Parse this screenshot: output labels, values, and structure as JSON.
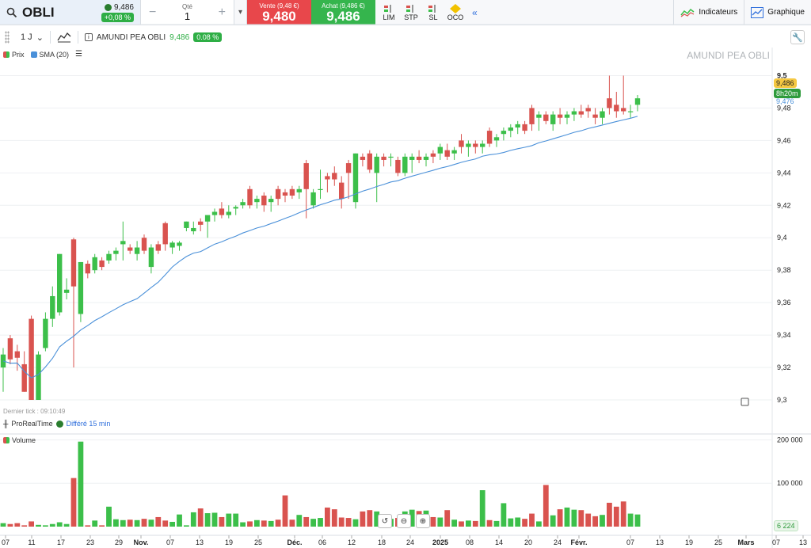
{
  "header": {
    "symbol": "OBLI",
    "last_price": "9,486",
    "change": "+0,08 %",
    "qty_label": "Qté",
    "qty_value": "1",
    "sell_label": "Vente (9,48 €)",
    "sell_price": "9,480",
    "buy_label": "Achat (9,486 €)",
    "buy_price": "9,486",
    "orders": [
      "LIM",
      "STP",
      "SL",
      "OCO"
    ],
    "indicators_label": "Indicateurs",
    "chart_label": "Graphique"
  },
  "toolbar": {
    "interval": "1 J",
    "instrument": "AMUNDI PEA OBLI",
    "price": "9,486",
    "change": "0.08 %"
  },
  "legend": {
    "price_label": "Prix",
    "sma_label": "SMA (20)"
  },
  "watermark": "AMUNDI PEA OBLI",
  "last_tick": "Dernier tick : 09:10:49",
  "source": "ProRealTime",
  "delay": "Différé 15 min",
  "volume_label": "Volume",
  "tags": {
    "price": "9,486",
    "countdown": "8h20m",
    "sma": "9,476",
    "volume": "6 224"
  },
  "colors": {
    "up": "#3cbf4a",
    "down": "#d9534f",
    "sma": "#4a90d9"
  },
  "chart_data": {
    "type": "candlestick",
    "y_ticks": [
      "9,5",
      "9,48",
      "9,46",
      "9,44",
      "9,42",
      "9,4",
      "9,38",
      "9,36",
      "9,34",
      "9,32",
      "9,3"
    ],
    "ylim": [
      9.3,
      9.51
    ],
    "volume_ticks": [
      "200 000",
      "100 000"
    ],
    "vol_max": 210000,
    "x_ticks": [
      "07",
      "11",
      "17",
      "23",
      "29",
      "Nov.",
      "07",
      "13",
      "19",
      "25",
      "Déc.",
      "06",
      "12",
      "18",
      "24",
      "2025",
      "08",
      "14",
      "20",
      "24",
      "Févr.",
      "07",
      "13",
      "19",
      "25",
      "Mars",
      "07",
      "13"
    ],
    "x_ticks_bold": [
      "Nov.",
      "Déc.",
      "2025",
      "Févr.",
      "Mars"
    ],
    "candles": [
      [
        9.32,
        9.332,
        9.305,
        9.328
      ],
      [
        9.338,
        9.34,
        9.322,
        9.325
      ],
      [
        9.33,
        9.334,
        9.318,
        9.326
      ],
      [
        9.322,
        9.33,
        9.305,
        9.305
      ],
      [
        9.35,
        9.352,
        9.3,
        9.3
      ],
      [
        9.3,
        9.33,
        9.3,
        9.328
      ],
      [
        9.332,
        9.354,
        9.33,
        9.35
      ],
      [
        9.35,
        9.37,
        9.345,
        9.364
      ],
      [
        9.354,
        9.39,
        9.352,
        9.39
      ],
      [
        9.366,
        9.375,
        9.362,
        9.368
      ],
      [
        9.399,
        9.4,
        9.32,
        9.37
      ],
      [
        9.353,
        9.385,
        9.348,
        9.385
      ],
      [
        9.384,
        9.386,
        9.375,
        9.378
      ],
      [
        9.38,
        9.39,
        9.378,
        9.388
      ],
      [
        9.386,
        9.388,
        9.38,
        9.382
      ],
      [
        9.386,
        9.392,
        9.384,
        9.39
      ],
      [
        9.39,
        9.394,
        9.386,
        9.392
      ],
      [
        9.396,
        9.41,
        9.386,
        9.398
      ],
      [
        9.394,
        9.396,
        9.39,
        9.392
      ],
      [
        9.39,
        9.398,
        9.386,
        9.394
      ],
      [
        9.4,
        9.402,
        9.39,
        9.392
      ],
      [
        9.382,
        9.396,
        9.378,
        9.394
      ],
      [
        9.396,
        9.398,
        9.39,
        9.392
      ],
      [
        9.409,
        9.41,
        9.392,
        9.396
      ],
      [
        9.394,
        9.398,
        9.39,
        9.397
      ],
      [
        9.395,
        9.398,
        9.392,
        9.397
      ],
      [
        9.406,
        9.41,
        9.404,
        9.41
      ],
      [
        9.404,
        9.41,
        9.402,
        9.406
      ],
      [
        9.41,
        9.412,
        9.404,
        9.408
      ],
      [
        9.41,
        9.412,
        9.4,
        9.414
      ],
      [
        9.414,
        9.418,
        9.41,
        9.416
      ],
      [
        9.418,
        9.422,
        9.412,
        9.414
      ],
      [
        9.414,
        9.42,
        9.412,
        9.416
      ],
      [
        9.418,
        9.42,
        9.414,
        9.419
      ],
      [
        9.42,
        9.424,
        9.418,
        9.422
      ],
      [
        9.43,
        9.432,
        9.418,
        9.42
      ],
      [
        9.422,
        9.426,
        9.418,
        9.424
      ],
      [
        9.426,
        9.428,
        9.416,
        9.42
      ],
      [
        9.422,
        9.426,
        9.416,
        9.424
      ],
      [
        9.43,
        9.432,
        9.42,
        9.424
      ],
      [
        9.428,
        9.43,
        9.422,
        9.426
      ],
      [
        9.43,
        9.432,
        9.424,
        9.426
      ],
      [
        9.428,
        9.432,
        9.424,
        9.43
      ],
      [
        9.446,
        9.448,
        9.412,
        9.43
      ],
      [
        9.42,
        9.43,
        9.418,
        9.428
      ],
      [
        9.43,
        9.442,
        9.424,
        9.43
      ],
      [
        9.438,
        9.44,
        9.428,
        9.436
      ],
      [
        9.44,
        9.444,
        9.432,
        9.436
      ],
      [
        9.434,
        9.438,
        9.418,
        9.424
      ],
      [
        9.446,
        9.448,
        9.424,
        9.44
      ],
      [
        9.422,
        9.452,
        9.418,
        9.452
      ],
      [
        9.45,
        9.452,
        9.444,
        9.448
      ],
      [
        9.452,
        9.454,
        9.44,
        9.442
      ],
      [
        9.44,
        9.452,
        9.422,
        9.45
      ],
      [
        9.45,
        9.452,
        9.444,
        9.448
      ],
      [
        9.45,
        9.452,
        9.444,
        9.45
      ],
      [
        9.448,
        9.45,
        9.438,
        9.44
      ],
      [
        9.44,
        9.452,
        9.438,
        9.45
      ],
      [
        9.448,
        9.452,
        9.44,
        9.45
      ],
      [
        9.45,
        9.454,
        9.446,
        9.448
      ],
      [
        9.448,
        9.452,
        9.444,
        9.45
      ],
      [
        9.452,
        9.454,
        9.446,
        9.45
      ],
      [
        9.452,
        9.458,
        9.448,
        9.456
      ],
      [
        9.454,
        9.458,
        9.448,
        9.45
      ],
      [
        9.452,
        9.456,
        9.448,
        9.454
      ],
      [
        9.46,
        9.464,
        9.452,
        9.456
      ],
      [
        9.456,
        9.46,
        9.45,
        9.458
      ],
      [
        9.458,
        9.46,
        9.452,
        9.456
      ],
      [
        9.456,
        9.46,
        9.452,
        9.458
      ],
      [
        9.466,
        9.468,
        9.456,
        9.458
      ],
      [
        9.46,
        9.464,
        9.456,
        9.462
      ],
      [
        9.464,
        9.468,
        9.46,
        9.466
      ],
      [
        9.466,
        9.47,
        9.462,
        9.468
      ],
      [
        9.468,
        9.472,
        9.464,
        9.47
      ],
      [
        9.47,
        9.472,
        9.464,
        9.466
      ],
      [
        9.48,
        9.482,
        9.466,
        9.47
      ],
      [
        9.474,
        9.478,
        9.466,
        9.476
      ],
      [
        9.476,
        9.478,
        9.47,
        9.472
      ],
      [
        9.47,
        9.478,
        9.466,
        9.476
      ],
      [
        9.476,
        9.48,
        9.47,
        9.474
      ],
      [
        9.474,
        9.478,
        9.47,
        9.476
      ],
      [
        9.476,
        9.48,
        9.472,
        9.478
      ],
      [
        9.478,
        9.482,
        9.474,
        9.476
      ],
      [
        9.48,
        9.482,
        9.474,
        9.478
      ],
      [
        9.476,
        9.48,
        9.47,
        9.474
      ],
      [
        9.474,
        9.48,
        9.47,
        9.478
      ],
      [
        9.486,
        9.5,
        9.476,
        9.48
      ],
      [
        9.482,
        9.49,
        9.474,
        9.478
      ],
      [
        9.48,
        9.5,
        9.476,
        9.478
      ],
      [
        9.478,
        9.482,
        9.474,
        9.478
      ],
      [
        9.482,
        9.488,
        9.478,
        9.486
      ]
    ],
    "volume": [
      8000,
      6000,
      8000,
      3000,
      12000,
      4000,
      3000,
      6000,
      10000,
      6000,
      112000,
      196000,
      3000,
      14000,
      3000,
      46000,
      17000,
      15000,
      16000,
      15000,
      18000,
      16000,
      22000,
      14000,
      11000,
      28000,
      3000,
      33000,
      42000,
      31000,
      32000,
      22000,
      30000,
      30000,
      10000,
      12000,
      15000,
      14000,
      13000,
      16000,
      72000,
      16000,
      27000,
      22000,
      18000,
      20000,
      44000,
      40000,
      21000,
      20000,
      17000,
      35000,
      38000,
      35000,
      6000,
      18000,
      20000,
      35000,
      39000,
      36000,
      37000,
      22000,
      21000,
      38000,
      16000,
      12000,
      14000,
      13000,
      84000,
      15000,
      13000,
      54000,
      19000,
      21000,
      18000,
      30000,
      12000,
      96000,
      26000,
      40000,
      44000,
      39000,
      38000,
      30000,
      24000,
      27000,
      55000,
      46000,
      58000,
      30000,
      28000,
      30000,
      26000,
      32000,
      6224
    ]
  }
}
